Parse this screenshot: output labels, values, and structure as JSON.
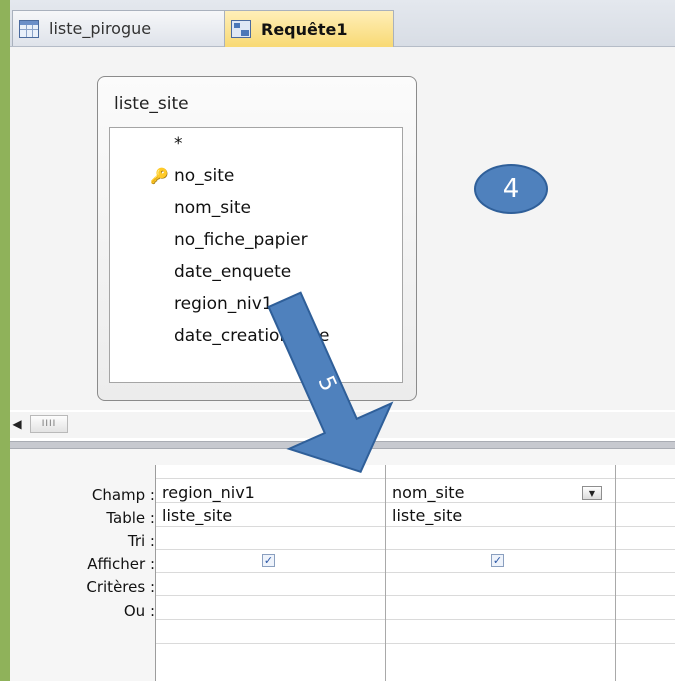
{
  "tabs": [
    {
      "label": "liste_pirogue",
      "icon": "table-icon",
      "active": false
    },
    {
      "label": "Requête1",
      "icon": "query-icon",
      "active": true
    }
  ],
  "table_box": {
    "title": "liste_site",
    "fields": [
      "*",
      "no_site",
      "nom_site",
      "no_fiche_papier",
      "date_enquete",
      "region_niv1",
      "date_creation_site"
    ],
    "primary_key_field": "no_site"
  },
  "annotations": {
    "step4_label": "4",
    "step5_label": "5",
    "arrow_color": "#4f81bd",
    "badge_color": "#4f81bd"
  },
  "query_grid": {
    "row_labels": [
      "Champ :",
      "Table :",
      "Tri :",
      "Afficher :",
      "Critères :",
      "Ou :"
    ],
    "columns": [
      {
        "champ": "region_niv1",
        "table": "liste_site",
        "tri": "",
        "afficher": true,
        "criteres": "",
        "ou": ""
      },
      {
        "champ": "nom_site",
        "table": "liste_site",
        "tri": "",
        "afficher": true,
        "criteres": "",
        "ou": ""
      }
    ]
  },
  "icons": {
    "key": "key-icon",
    "dropdown": "chevron-down-icon",
    "scroll_left": "scroll-left-icon"
  }
}
